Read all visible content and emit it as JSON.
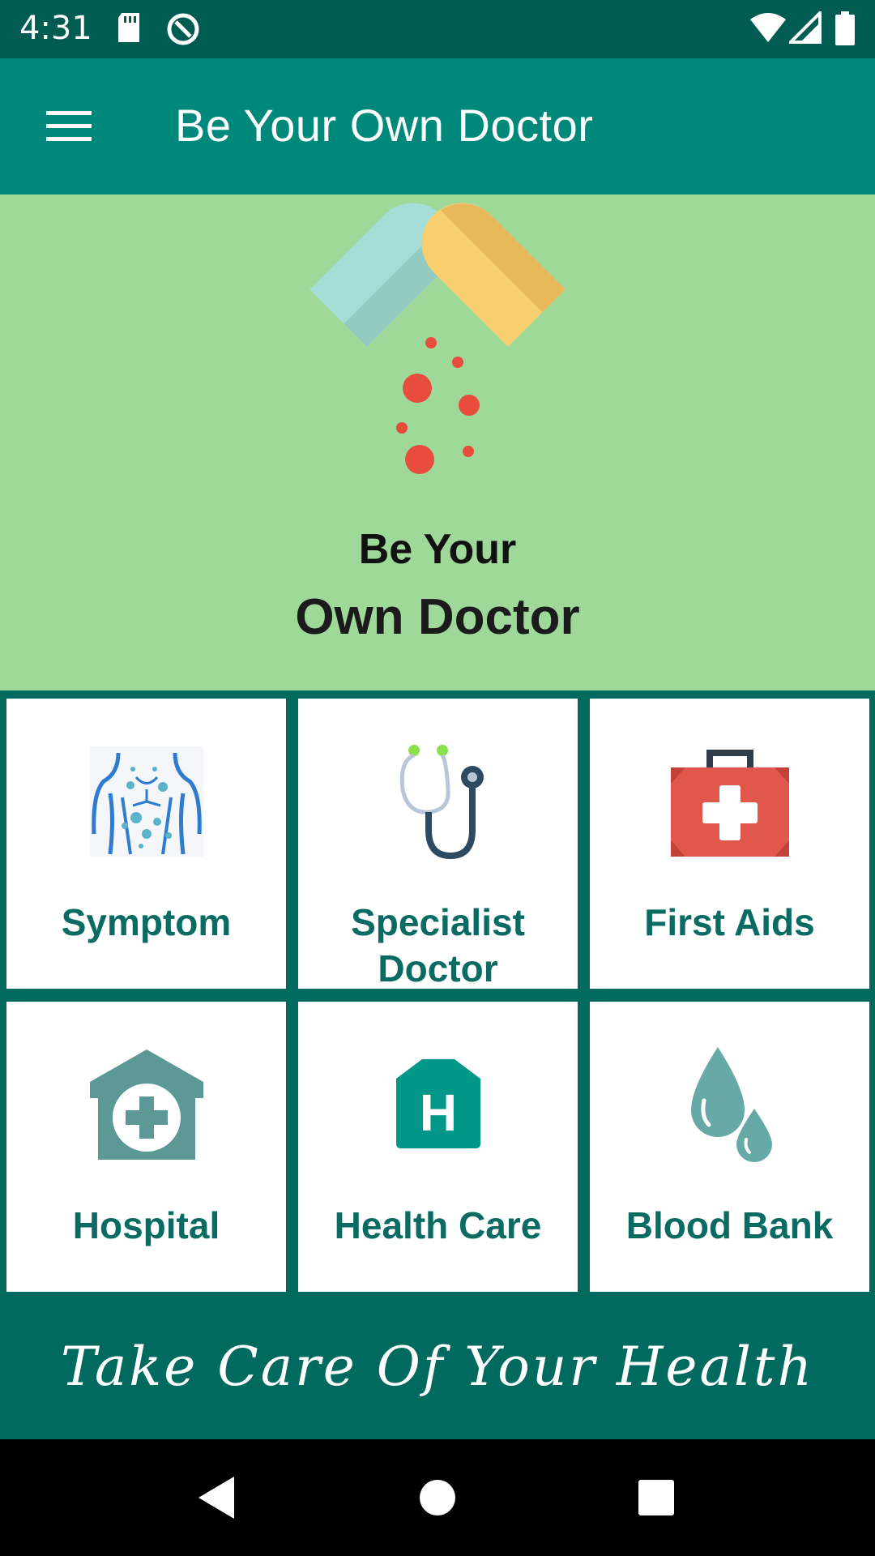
{
  "status_bar": {
    "time": "4:31",
    "icons": [
      "sd-card-icon",
      "no-disturb-icon",
      "wifi-icon",
      "signal-icon",
      "battery-icon"
    ]
  },
  "app_bar": {
    "title": "Be Your Own Doctor",
    "menu_icon": "hamburger-menu-icon"
  },
  "hero": {
    "logo_icon": "pill-capsule-icon",
    "line1": "Be Your",
    "line2": "Own Doctor"
  },
  "cards": [
    {
      "label": "Symptom",
      "icon": "body-symptom-icon"
    },
    {
      "label": "Specialist Doctor",
      "icon": "stethoscope-icon"
    },
    {
      "label": "First Aids",
      "icon": "first-aid-kit-icon"
    },
    {
      "label": "Hospital",
      "icon": "hospital-icon"
    },
    {
      "label": "Health Care",
      "icon": "health-care-icon"
    },
    {
      "label": "Blood Bank",
      "icon": "blood-drop-icon"
    }
  ],
  "footer": {
    "text": "Take Care Of Your Health"
  },
  "nav_bar": {
    "icons": [
      "back-icon",
      "home-icon",
      "recents-icon"
    ]
  },
  "colors": {
    "status_bar": "#005b51",
    "app_bar": "#00897b",
    "hero_bg": "#9fd99a",
    "grid_bg": "#006a5f",
    "card_text": "#0a6b62"
  }
}
